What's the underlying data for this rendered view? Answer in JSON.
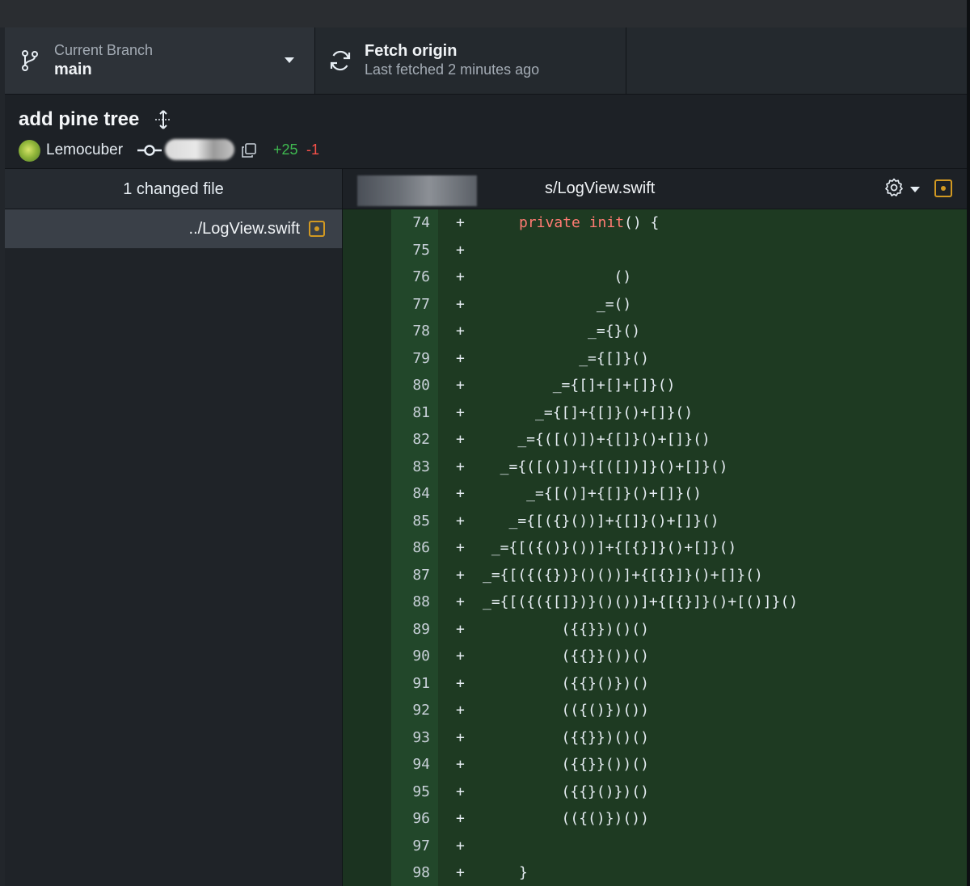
{
  "toolbar": {
    "branch_label": "Current Branch",
    "branch_name": "main",
    "fetch_title": "Fetch origin",
    "fetch_subtitle": "Last fetched 2 minutes ago"
  },
  "commit": {
    "title": "add pine tree",
    "author": "Lemocuber",
    "additions": "+25",
    "deletions": "-1"
  },
  "files": {
    "changed_count": "1 changed file",
    "items": [
      {
        "name": "../LogView.swift",
        "status": "modified"
      }
    ]
  },
  "diff": {
    "path": "s/LogView.swift",
    "lines": [
      {
        "num": "74",
        "sign": "+",
        "keyword": "private init",
        "code": "() {"
      },
      {
        "num": "75",
        "sign": "+",
        "keyword": "",
        "code": ""
      },
      {
        "num": "76",
        "sign": "+",
        "keyword": "",
        "code": "               ()"
      },
      {
        "num": "77",
        "sign": "+",
        "keyword": "",
        "code": "             _=()"
      },
      {
        "num": "78",
        "sign": "+",
        "keyword": "",
        "code": "            _={}()"
      },
      {
        "num": "79",
        "sign": "+",
        "keyword": "",
        "code": "           _={[]}()"
      },
      {
        "num": "80",
        "sign": "+",
        "keyword": "",
        "code": "        _={[]+[]+[]}()"
      },
      {
        "num": "81",
        "sign": "+",
        "keyword": "",
        "code": "      _={[]+{[]}()+[]}()"
      },
      {
        "num": "82",
        "sign": "+",
        "keyword": "",
        "code": "    _={([()])+{[]}()+[]}()"
      },
      {
        "num": "83",
        "sign": "+",
        "keyword": "",
        "code": "  _={([()])+{[([])]}()+[]}()"
      },
      {
        "num": "84",
        "sign": "+",
        "keyword": "",
        "code": "     _={[()]+{[]}()+[]}()"
      },
      {
        "num": "85",
        "sign": "+",
        "keyword": "",
        "code": "   _={[({}())]+{[]}()+[]}()"
      },
      {
        "num": "86",
        "sign": "+",
        "keyword": "",
        "code": " _={[({()}())]+{[{}]}()+[]}()"
      },
      {
        "num": "87",
        "sign": "+",
        "keyword": "",
        "code": "_={[({({})}()())]+{[{}]}()+[]}()"
      },
      {
        "num": "88",
        "sign": "+",
        "keyword": "",
        "code": "_={[({({[]})}()())]+{[{}]}()+[()]}()"
      },
      {
        "num": "89",
        "sign": "+",
        "keyword": "",
        "code": "         ({{}})()()"
      },
      {
        "num": "90",
        "sign": "+",
        "keyword": "",
        "code": "         ({{}}())()"
      },
      {
        "num": "91",
        "sign": "+",
        "keyword": "",
        "code": "         ({{}()})()"
      },
      {
        "num": "92",
        "sign": "+",
        "keyword": "",
        "code": "         (({()})())"
      },
      {
        "num": "93",
        "sign": "+",
        "keyword": "",
        "code": "         ({{}})()()"
      },
      {
        "num": "94",
        "sign": "+",
        "keyword": "",
        "code": "         ({{}}())()"
      },
      {
        "num": "95",
        "sign": "+",
        "keyword": "",
        "code": "         ({{}()})()"
      },
      {
        "num": "96",
        "sign": "+",
        "keyword": "",
        "code": "         (({()})())"
      },
      {
        "num": "97",
        "sign": "+",
        "keyword": "",
        "code": ""
      },
      {
        "num": "98",
        "sign": "+",
        "keyword": "",
        "code": "}"
      }
    ]
  }
}
